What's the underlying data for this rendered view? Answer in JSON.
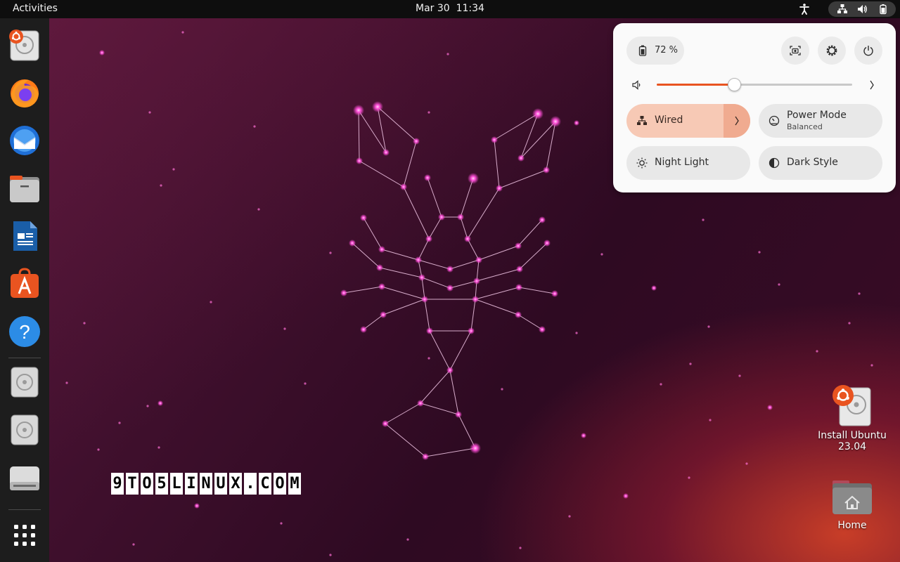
{
  "topbar": {
    "activities_label": "Activities",
    "date": "Mar 30",
    "time": "11:34"
  },
  "dock": {
    "items": [
      {
        "name": "Install Ubuntu",
        "icon": "ubuntu-installer-icon"
      },
      {
        "name": "Firefox",
        "icon": "firefox-icon"
      },
      {
        "name": "Thunderbird",
        "icon": "thunderbird-icon"
      },
      {
        "name": "Files",
        "icon": "files-icon"
      },
      {
        "name": "LibreOffice Writer",
        "icon": "writer-icon"
      },
      {
        "name": "Ubuntu Software",
        "icon": "app-store-icon"
      },
      {
        "name": "Help",
        "icon": "help-icon"
      },
      {
        "name": "Disc",
        "icon": "disc-icon"
      },
      {
        "name": "Disc",
        "icon": "disc-icon"
      },
      {
        "name": "Drive",
        "icon": "drive-icon"
      },
      {
        "name": "Show Applications",
        "icon": "app-grid-icon"
      }
    ]
  },
  "quick_settings": {
    "battery": "72 %",
    "volume_level": 0.4,
    "toggles": {
      "wired": {
        "label": "Wired",
        "active": true
      },
      "power_mode": {
        "label": "Power Mode",
        "sublabel": "Balanced"
      },
      "night_light": {
        "label": "Night Light"
      },
      "dark_style": {
        "label": "Dark Style"
      }
    }
  },
  "desktop": {
    "install_icon": {
      "line1": "Install Ubuntu",
      "line2": "23.04"
    },
    "home_icon": {
      "label": "Home"
    }
  },
  "watermark": {
    "text": "9TO5LINUX.COM"
  },
  "colors": {
    "accent": "#e95420",
    "panel_bg": "#fafafa",
    "wired_active": "#f7c9b5",
    "topbar_bg": "#0e0e0e",
    "dock_bg": "#1d1d1d",
    "constellation": "#ff4fd8"
  }
}
